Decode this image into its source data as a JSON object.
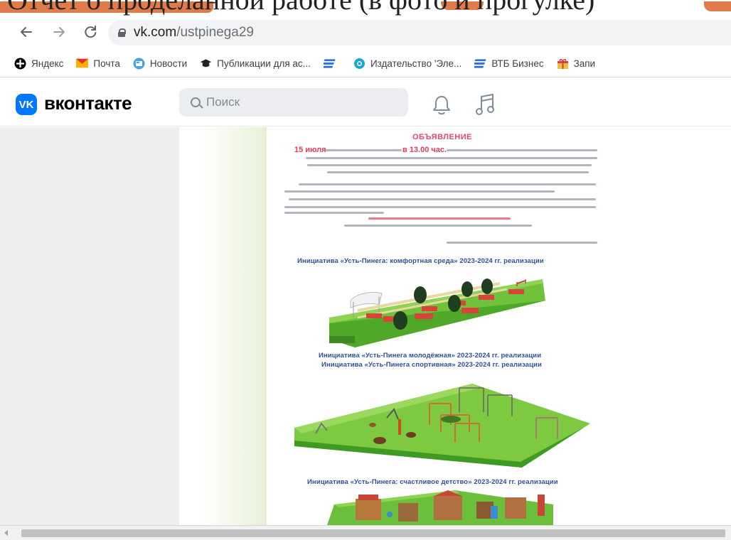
{
  "slide": {
    "title": "Отчет о проделанной работе (в фото и прогулке)"
  },
  "browser": {
    "back_icon": "arrow-left-icon",
    "forward_icon": "arrow-right-icon",
    "reload_icon": "reload-icon",
    "url_host": "vk.com",
    "url_path": "/ustpinega29",
    "bookmarks": [
      {
        "label": "Яндекс",
        "icon": "yandex-icon",
        "color": "#000000"
      },
      {
        "label": "Почта",
        "icon": "mail-icon",
        "color": "#ff9900"
      },
      {
        "label": "Новости",
        "icon": "news-icon",
        "color": "#2f7bd8"
      },
      {
        "label": "Публикации для ас...",
        "icon": "graduation-cap-icon",
        "color": "#333333"
      },
      {
        "label": "",
        "icon": "blue-lines-icon",
        "color": "#2f6fe0"
      },
      {
        "label": "Издательство 'Эле...",
        "icon": "globe-icon",
        "color": "#1a9fd0"
      },
      {
        "label": "ВТБ Бизнес",
        "icon": "vtb-icon",
        "color": "#2f6fe0"
      },
      {
        "label": "Запи",
        "icon": "gift-icon",
        "color": "#d94040"
      }
    ]
  },
  "vk": {
    "logo_text": "VK",
    "brand": "вконтакте",
    "search_placeholder": "Поиск",
    "accent": "#0077ff"
  },
  "poster": {
    "title": "ОБЪЯВЛЕНИЕ",
    "date_text": "15 июля",
    "time_text": "в 13.00 час.",
    "captions": [
      "Инициатива «Усть-Пинега: комфортная среда» 2023-2024 гг. реализации",
      "Инициатива «Усть-Пинега молодёжная» 2023-2024 гг. реализации",
      "Инициатива «Усть-Пинега спортивная» 2023-2024 гг. реализации",
      "Инициатива «Усть-Пинега: счастливое детство» 2023-2024 гг. реализации"
    ],
    "title_color": "#e4477a",
    "caption_color": "#2c4fa3"
  }
}
